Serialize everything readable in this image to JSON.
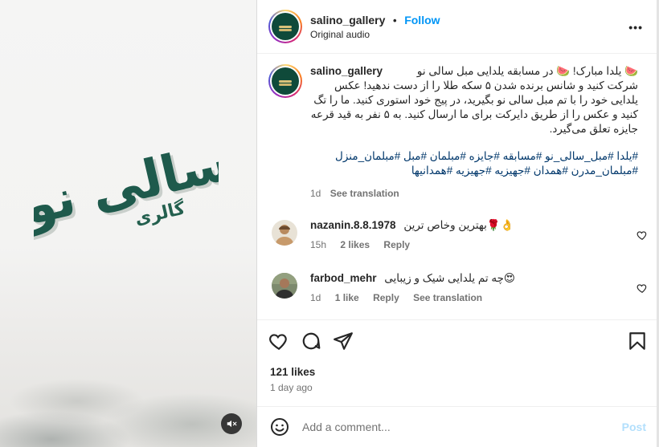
{
  "post": {
    "username": "salino_gallery",
    "follow_label": "Follow",
    "audio_label": "Original audio",
    "more_label": "•••"
  },
  "media": {
    "logo_text_main": "سالی نو",
    "logo_text_sub": "گالری",
    "mute_icon": "speaker-muted-icon",
    "brand_color": "#1e5a4c"
  },
  "caption": {
    "username": "salino_gallery",
    "text": "🍉 یلدا مبارک! 🍉 در مسابقه یلدایی مبل سالی نو شرکت کنید و شانس برنده شدن ۵ سکه طلا را از دست ندهید! عکس یلدایی خود را با تم مبل سالی نو بگیرید، در پیج خود استوری کنید. ما را تگ کنید و عکس را از طریق دایرکت برای ما ارسال کنید. به ۵ نفر به قید قرعه جایزه تعلق می‌گیرد.",
    "hashtags": "#یلدا #مبل_سالی_نو #مسابقه #جایزه #مبلمان #مبل #مبلمان_منزل #مبلمان_مدرن #همدان #جهیزیه #جهیزیه #همدانیها",
    "age": "1d",
    "see_translation": "See translation"
  },
  "comments": [
    {
      "username": "nazanin.8.8.1978",
      "text": "بهترین وخاص ترین🌹👌",
      "age": "15h",
      "likes": "2 likes",
      "reply": "Reply"
    },
    {
      "username": "farbod_mehr",
      "text": "چه تم یلدایی شیک و زیبایی😍",
      "age": "1d",
      "likes": "1 like",
      "reply": "Reply",
      "see_translation": "See translation"
    }
  ],
  "stats": {
    "likes": "121 likes",
    "posted": "1 day ago"
  },
  "compose": {
    "placeholder": "Add a comment...",
    "post_label": "Post"
  },
  "colors": {
    "link": "#0095f6",
    "hashtag": "#00376b",
    "muted": "#737373",
    "post_disabled": "#b2dffc"
  }
}
